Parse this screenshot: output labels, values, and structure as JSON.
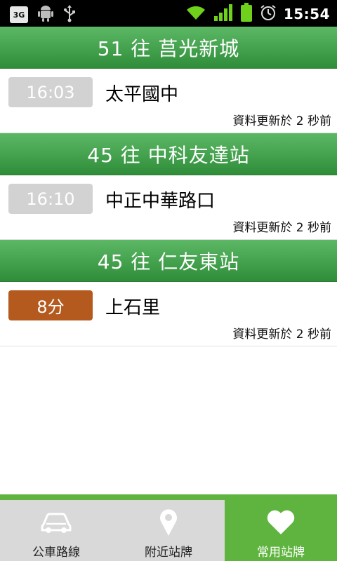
{
  "status_bar": {
    "network_badge": "3G",
    "time": "15:54",
    "icons": [
      "android-icon",
      "usb-icon",
      "wifi-icon",
      "signal-icon",
      "battery-icon",
      "alarm-icon"
    ]
  },
  "arrivals": [
    {
      "route_title": "51  往 莒光新城",
      "eta": "16:03",
      "eta_style": "scheduled",
      "stop": "太平國中",
      "updated": "資料更新於 2 秒前"
    },
    {
      "route_title": "45  往 中科友達站",
      "eta": "16:10",
      "eta_style": "scheduled",
      "stop": "中正中華路口",
      "updated": "資料更新於 2 秒前"
    },
    {
      "route_title": "45  往 仁友東站",
      "eta": "8分",
      "eta_style": "imminent",
      "stop": "上石里",
      "updated": "資料更新於 2 秒前"
    }
  ],
  "tabs": [
    {
      "label": "公車路線",
      "icon": "car-icon",
      "active": false
    },
    {
      "label": "附近站牌",
      "icon": "map-pin-icon",
      "active": false
    },
    {
      "label": "常用站牌",
      "icon": "heart-icon",
      "active": true
    }
  ],
  "colors": {
    "header_green": "#3e9e48",
    "active_tab": "#5fb43f",
    "eta_scheduled": "#d2d2d2",
    "eta_imminent": "#b45a1f"
  }
}
